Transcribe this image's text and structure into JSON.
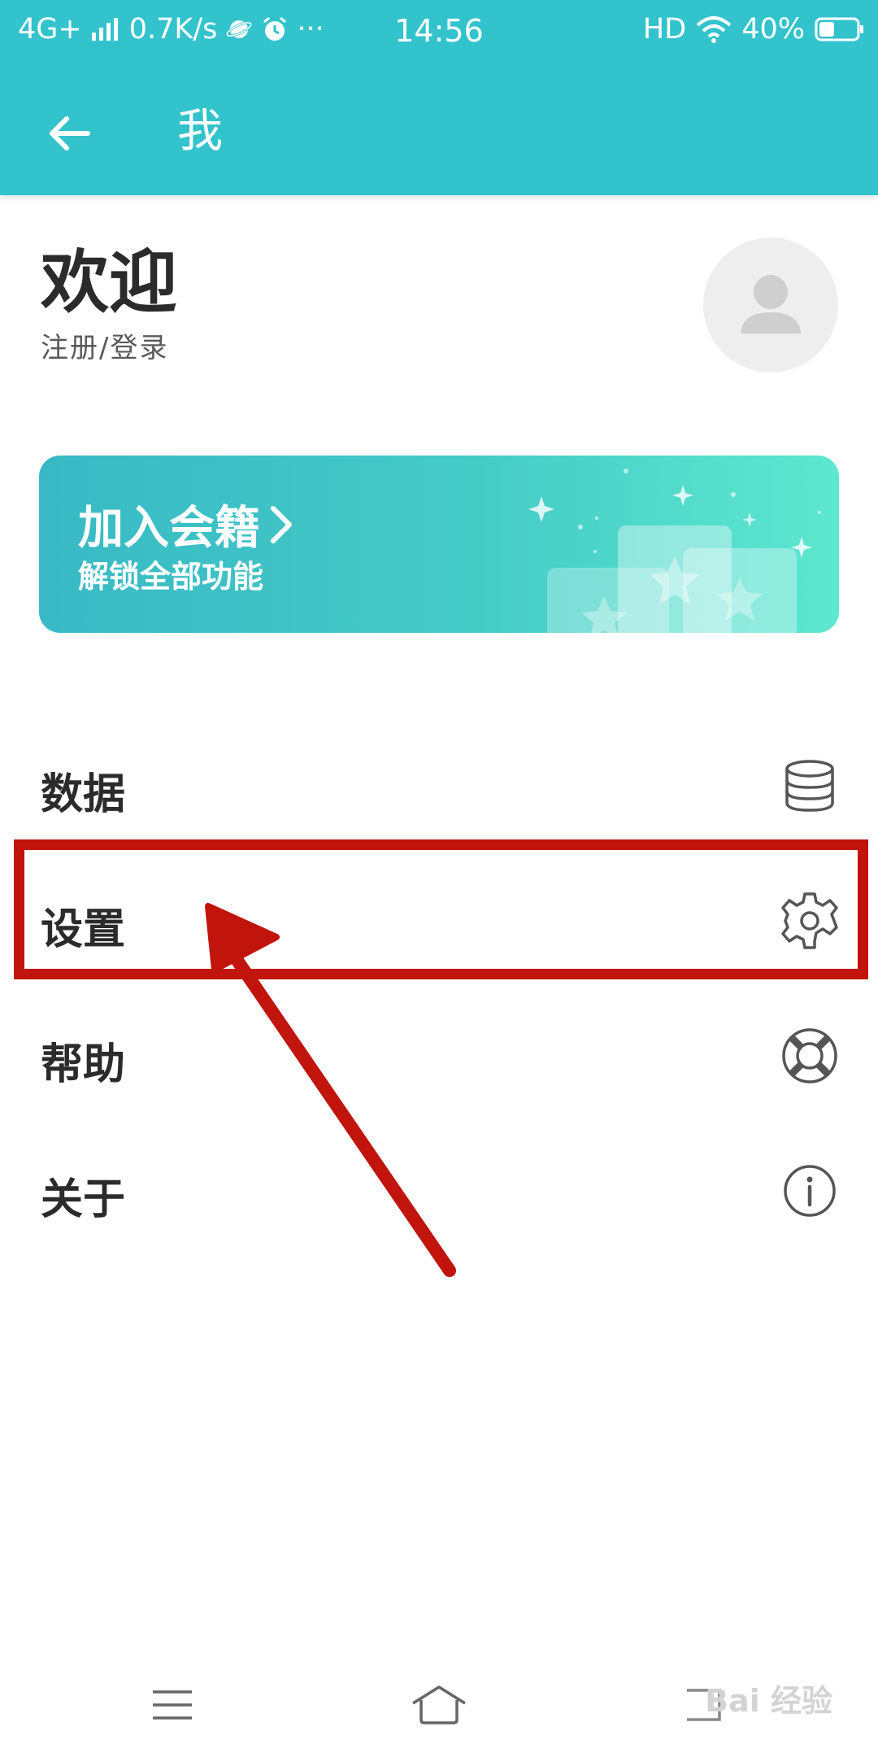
{
  "status_bar": {
    "network": "4G+",
    "speed": "0.7K/s",
    "more": "···",
    "time": "14:56",
    "hd": "HD",
    "battery": "40%",
    "battery_level": 0.4
  },
  "header": {
    "title": "我",
    "back_icon": "arrow-left-icon",
    "color": "#33c3cc"
  },
  "profile": {
    "welcome": "欢迎",
    "login": "注册/登录",
    "avatar_icon": "user-avatar-icon"
  },
  "banner": {
    "title": "加入会籍",
    "subtitle": "解锁全部功能",
    "gradient": [
      "#38b9c5",
      "#5ee8cf"
    ]
  },
  "menu": {
    "items": [
      {
        "label": "数据",
        "icon": "database-icon"
      },
      {
        "label": "设置",
        "icon": "gear-icon"
      },
      {
        "label": "帮助",
        "icon": "lifebuoy-icon"
      },
      {
        "label": "关于",
        "icon": "info-icon"
      }
    ]
  },
  "annotation": {
    "color": "#c0140c",
    "highlighted_item": "设置"
  },
  "nav_bar": {
    "menu_icon": "hamburger-icon",
    "home_icon": "home-icon",
    "back_icon": "recent-icon"
  },
  "watermark": {
    "text": "Bai 经验"
  }
}
